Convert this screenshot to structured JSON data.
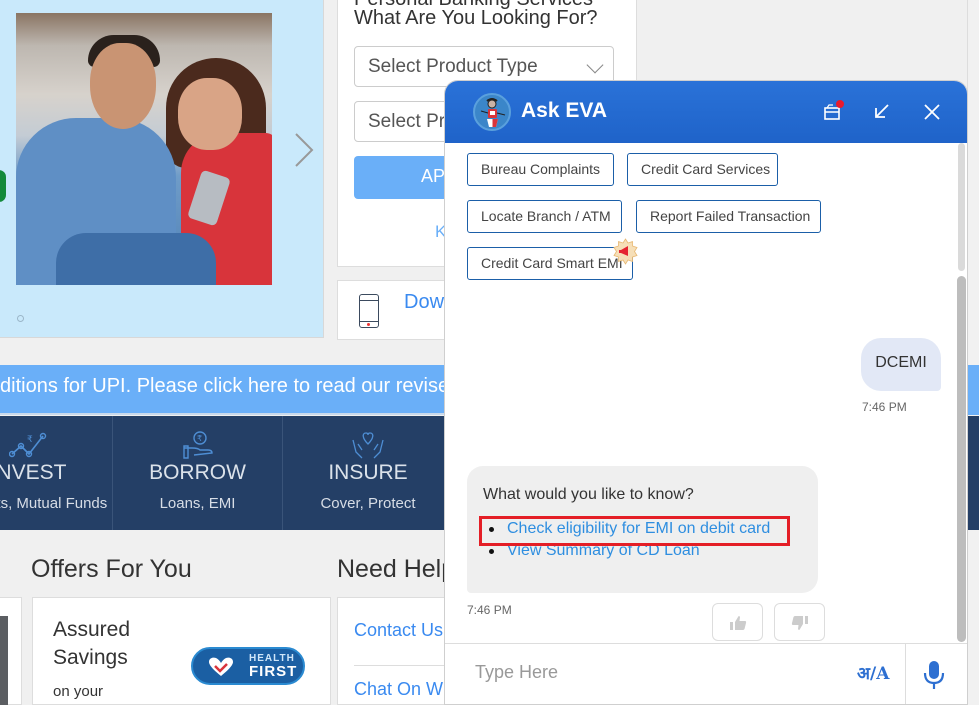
{
  "hero": {
    "next_icon": "chevron-right-icon",
    "slide_dot_icon": "carousel-dot-icon"
  },
  "finder": {
    "title_top": "Personal Banking Services",
    "title": "What Are You Looking For?",
    "select_product_type": "Select Product Type",
    "select_product": "Select Product",
    "apply_label": "APPLY NOW",
    "link_label": "Know More",
    "download_label": "Download App"
  },
  "notice": {
    "text": "ditions for UPI. Please click here to read our revised Terms and Conditions"
  },
  "categories": [
    {
      "title": "INVEST",
      "sub": "Deposits, Mutual Funds",
      "icon": "invest-chart-icon"
    },
    {
      "title": "BORROW",
      "sub": "Loans, EMI",
      "icon": "borrow-hand-coin-icon"
    },
    {
      "title": "INSURE",
      "sub": "Cover, Protect",
      "icon": "insure-hands-heart-icon"
    }
  ],
  "offers": {
    "title": "Offers For You",
    "card_title": "Assured Savings",
    "card_sub": "on your",
    "badge_line1": "HEALTH",
    "badge_line2": "FIRST"
  },
  "help": {
    "title": "Need Help?",
    "contact_label": "Contact Us",
    "chat_label": "Chat On WhatsApp"
  },
  "chat": {
    "title": "Ask EVA",
    "header_icons": [
      "notification-box-icon",
      "minimize-icon",
      "close-icon"
    ],
    "chips": [
      "Bureau Complaints",
      "Credit Card Services",
      "Locate Branch / ATM",
      "Report Failed Transaction",
      "Credit Card Smart EMI"
    ],
    "user_message": "DCEMI",
    "user_time": "7:46 PM",
    "bot_question": "What would you like to know?",
    "bot_options": [
      "Check eligibility for EMI on debit card",
      "View Summary of CD Loan"
    ],
    "bot_time": "7:46 PM",
    "input_placeholder": "Type Here",
    "lang_toggle": "अ/A",
    "colors": {
      "header": "#1f63c9",
      "chip_border": "#1b5fa8",
      "link": "#2e8ee0",
      "highlight": "#e41e26"
    }
  }
}
